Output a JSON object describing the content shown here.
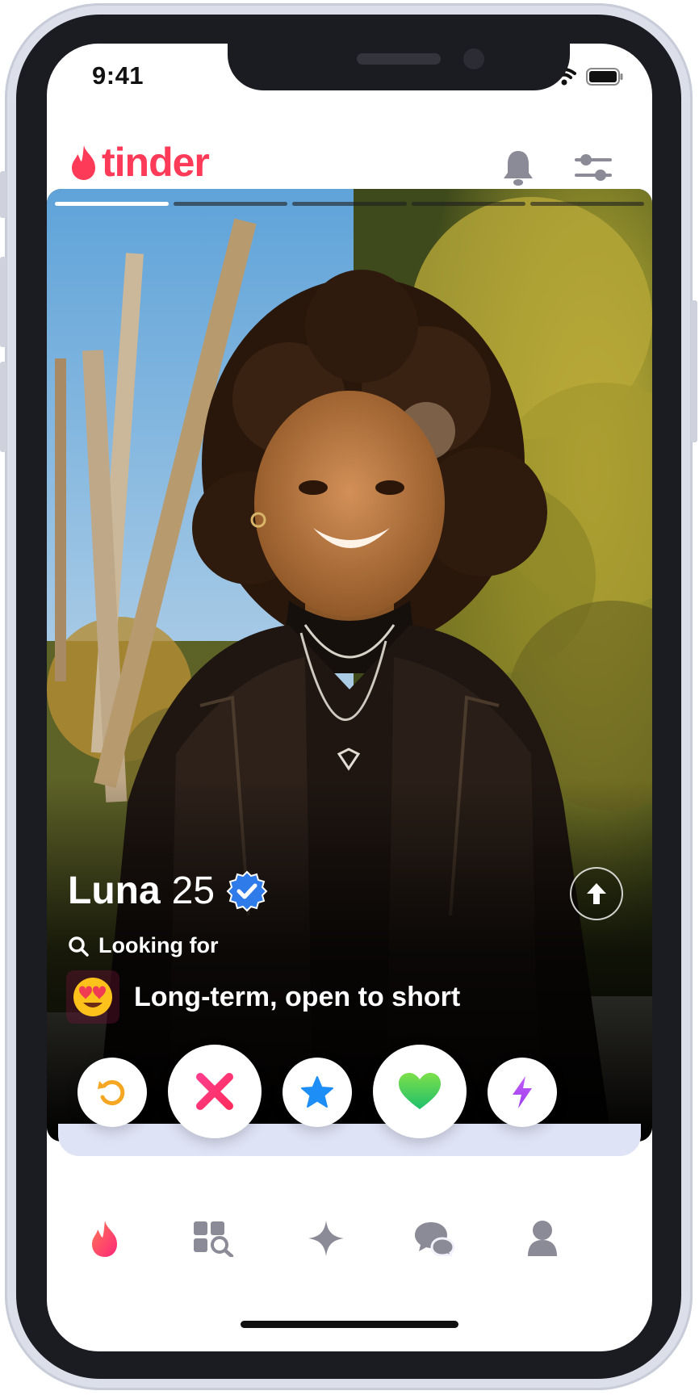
{
  "status_bar": {
    "time": "9:41"
  },
  "header": {
    "logo_text": "tinder",
    "brand_color": "#fd3a57"
  },
  "card": {
    "photo_count": 5,
    "active_photo": 1,
    "name": "Luna",
    "age": "25",
    "verified": true,
    "looking_for_label": "Looking for",
    "looking_for_value": "Long-term, open to short",
    "looking_for_emoji": "😍"
  },
  "actions": [
    {
      "name": "rewind",
      "icon": "rewind-icon"
    },
    {
      "name": "nope",
      "icon": "x-icon"
    },
    {
      "name": "super-like",
      "icon": "star-icon"
    },
    {
      "name": "like",
      "icon": "heart-icon"
    },
    {
      "name": "boost",
      "icon": "bolt-icon"
    }
  ],
  "nav": [
    {
      "name": "home",
      "icon": "flame-icon",
      "active": true
    },
    {
      "name": "explore",
      "icon": "explore-grid-icon"
    },
    {
      "name": "gold",
      "icon": "sparkle-icon"
    },
    {
      "name": "messages",
      "icon": "chat-icon"
    },
    {
      "name": "profile",
      "icon": "person-icon"
    }
  ]
}
